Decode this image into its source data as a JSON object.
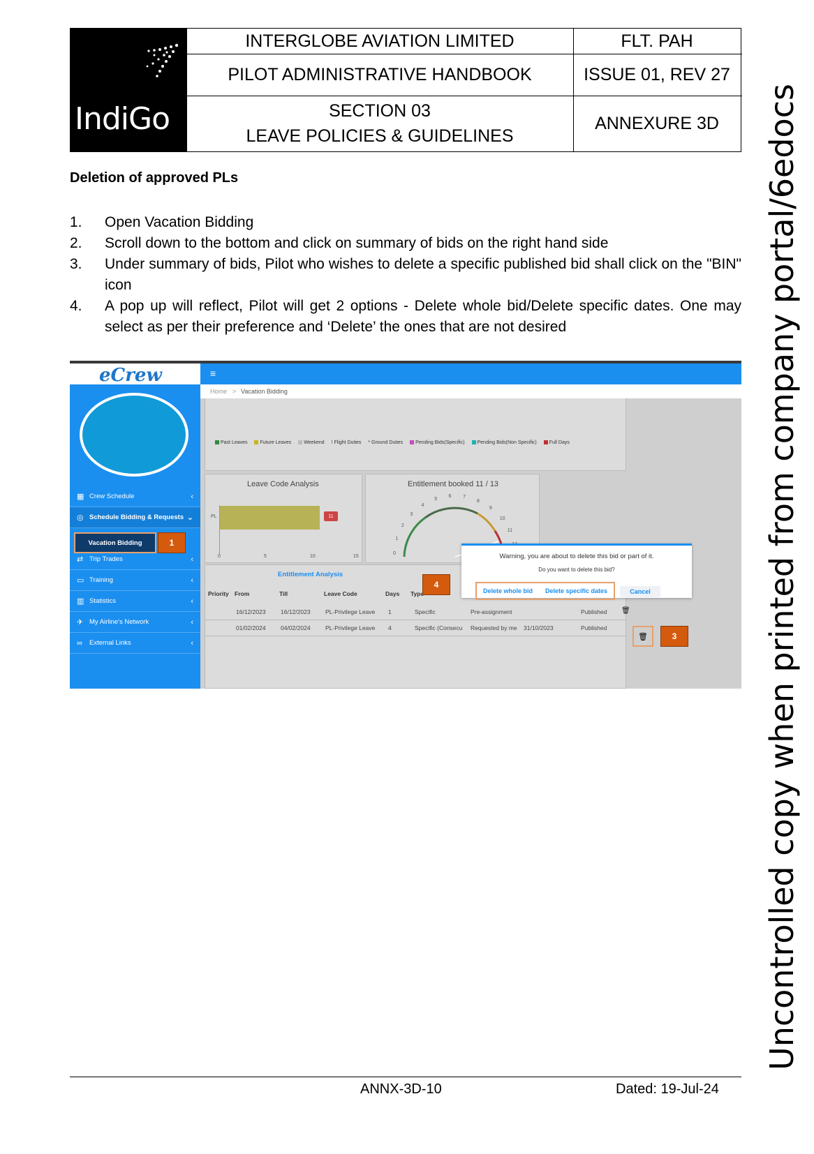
{
  "header": {
    "brand": "IndiGo",
    "company": "INTERGLOBE AVIATION LIMITED",
    "code": "FLT. PAH",
    "handbook": "PILOT ADMINISTRATIVE HANDBOOK",
    "issue": "ISSUE 01, REV 27",
    "section_line1": "SECTION 03",
    "section_line2": "LEAVE POLICIES & GUIDELINES",
    "annexure": "ANNEXURE 3D"
  },
  "title": "Deletion of approved PLs",
  "steps": [
    {
      "num": "1.",
      "text": "Open Vacation Bidding"
    },
    {
      "num": "2.",
      "text": "Scroll down to the bottom and click on summary of bids on the right hand side"
    },
    {
      "num": "3.",
      "text": "Under summary of bids, Pilot who wishes to delete a specific published bid shall click on the \"BIN\" icon"
    },
    {
      "num": "4.",
      "text": "A pop up will reflect, Pilot will get 2 options - Delete whole bid/Delete specific dates. One may select as per their preference and ‘Delete’ the ones that are not desired"
    }
  ],
  "screenshot": {
    "app_logo": "eCrew",
    "breadcrumb_home": "Home",
    "breadcrumb_sep": ">",
    "breadcrumb_page": "Vacation Bidding",
    "menu_icon": "≡",
    "sidebar": [
      {
        "icon": "calendar-icon",
        "glyph": "▦",
        "label": "Crew Schedule"
      },
      {
        "icon": "bidding-icon",
        "glyph": "◎",
        "label": "Schedule Bidding & Requests"
      },
      {
        "icon": "trade-icon",
        "glyph": "⇄",
        "label": "Trip Trades"
      },
      {
        "icon": "training-icon",
        "glyph": "▭",
        "label": "Training"
      },
      {
        "icon": "statistics-icon",
        "glyph": "▥",
        "label": "Statistics"
      },
      {
        "icon": "plane-icon",
        "glyph": "✈",
        "label": "My Airline's Network"
      },
      {
        "icon": "link-icon",
        "glyph": "∞",
        "label": "External Links"
      }
    ],
    "vacation_bidding": "Vacation Bidding",
    "legend": [
      {
        "label": "Past Leaves",
        "color": "#2e8b3a"
      },
      {
        "label": "Future Leaves",
        "color": "#c8b320"
      },
      {
        "label": "Weekend",
        "color": "#bdbdbd"
      },
      {
        "label": "! Flight Duties",
        "color": ""
      },
      {
        "label": "* Ground Duties",
        "color": ""
      },
      {
        "label": "Pending Bids(Specific)",
        "color": "#c050c0"
      },
      {
        "label": "Pending Bids(Non Specific)",
        "color": "#20b0b0"
      },
      {
        "label": "Full Days",
        "color": "#c03030"
      }
    ],
    "leave_code_title": "Leave Code Analysis",
    "bar_label": "PL",
    "bar_value": "11",
    "bar_ticks": [
      "0",
      "5",
      "10",
      "15"
    ],
    "entitlement_title": "Entitlement booked 11 / 13",
    "gauge_ticks": [
      "0",
      "1",
      "2",
      "3",
      "4",
      "5",
      "6",
      "7",
      "8",
      "9",
      "10",
      "11",
      "12"
    ],
    "tab_label": "Entitlement Analysis",
    "table_headers": [
      "Priority",
      "From",
      "Till",
      "Leave Code",
      "Days",
      "Type"
    ],
    "rows": [
      {
        "from": "16/12/2023",
        "till": "16/12/2023",
        "code": "PL-Privilege Leave",
        "days": "1",
        "type": "Specific",
        "req": "Pre-assignment",
        "date": "",
        "status": "Published"
      },
      {
        "from": "01/02/2024",
        "till": "04/02/2024",
        "code": "PL-Privilege Leave",
        "days": "4",
        "type": "Specific (Consecu",
        "req": "Requested by me",
        "date": "31/10/2023",
        "status": "Published"
      }
    ],
    "dialog": {
      "warning": "Warning, you are about to delete this bid or part of it.",
      "question": "Do you want to delete this bid?",
      "delete_whole": "Delete whole bid",
      "delete_specific": "Delete specific dates",
      "cancel": "Cancel"
    },
    "badges": [
      "1",
      "3",
      "4"
    ],
    "accent": "#1a8ff0",
    "highlight": "#e8a06c",
    "badge_color": "#d45a0e"
  },
  "footer": {
    "code": "ANNX-3D-10",
    "date": "Dated: 19-Jul-24"
  },
  "watermark": "Uncontrolled copy when printed from company portal/6edocs"
}
